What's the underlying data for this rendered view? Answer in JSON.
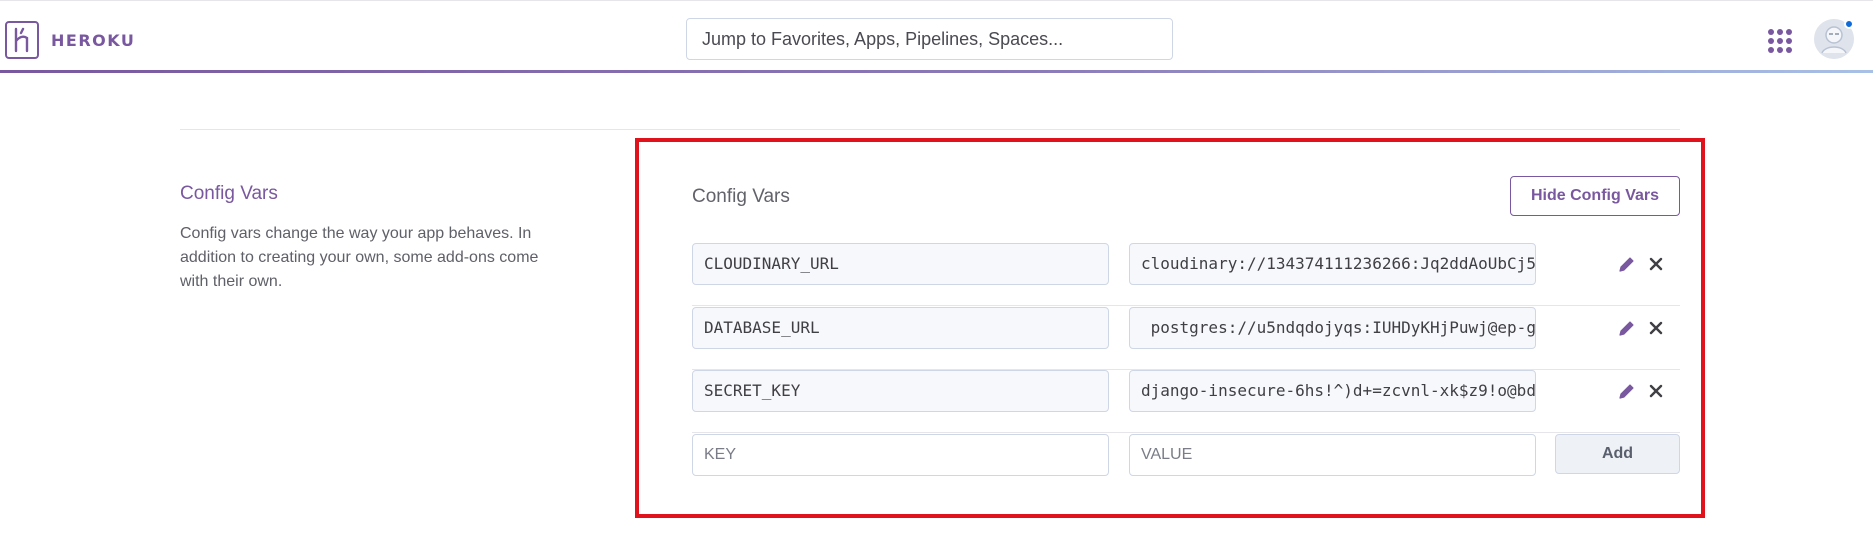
{
  "header": {
    "logo_text": "HEROKU",
    "search_placeholder": "Jump to Favorites, Apps, Pipelines, Spaces..."
  },
  "section": {
    "title": "Config Vars",
    "description": "Config vars change the way your app behaves. In addition to creating your own, some add-ons come with their own."
  },
  "panel": {
    "title": "Config Vars",
    "hide_button": "Hide Config Vars",
    "vars": [
      {
        "key": "CLOUDINARY_URL",
        "value": "cloudinary://134374111236266:Jq2ddAoUbCj5"
      },
      {
        "key": "DATABASE_URL",
        "value": " postgres://u5ndqdojyqs:IUHDyKHjPuwj@ep-g"
      },
      {
        "key": "SECRET_KEY",
        "value": "django-insecure-6hs!^)d+=zcvnl-xk$z9!o@bd"
      }
    ],
    "new_key_placeholder": "KEY",
    "new_value_placeholder": "VALUE",
    "add_button": "Add"
  },
  "icons": {
    "apps": "grid-dots-icon",
    "edit": "pencil-icon",
    "delete": "close-icon"
  },
  "colors": {
    "brand": "#79589f",
    "highlight": "#e0121b",
    "notification": "#0f6bd8"
  }
}
